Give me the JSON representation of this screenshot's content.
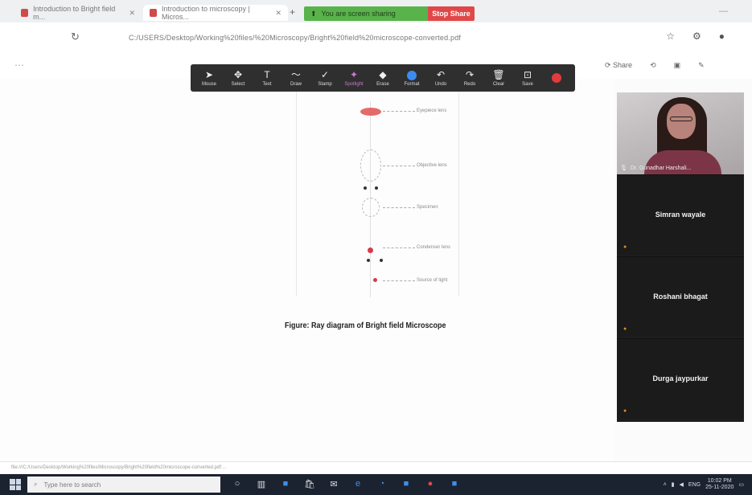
{
  "browser": {
    "tabs": [
      {
        "label": "Introduction to Bright field m..."
      },
      {
        "label": "Introduction to microscopy | Micros..."
      }
    ],
    "new_tab": "+",
    "share": {
      "status": "You are screen sharing",
      "stop_label": "Stop Share"
    },
    "minimize": "—",
    "url": "C:/USERS/Desktop/Working%20files/%20Microscopy/Bright%20field%20microscope-converted.pdf",
    "nav": {
      "back": "←",
      "reload": "↻"
    }
  },
  "pdf_toolbar": {
    "share_label": "Share",
    "icons": [
      "share-icon",
      "rotate-icon",
      "save-icon",
      "pen-icon"
    ]
  },
  "annotate_toolbar": {
    "tools": [
      {
        "label": "Mouse",
        "glyph": "➤"
      },
      {
        "label": "Select",
        "glyph": "✥"
      },
      {
        "label": "Text",
        "glyph": "T"
      },
      {
        "label": "Draw",
        "glyph": "〜"
      },
      {
        "label": "Stamp",
        "glyph": "✓"
      },
      {
        "label": "Spotlight",
        "glyph": "✦"
      },
      {
        "label": "Erase",
        "glyph": "◆"
      },
      {
        "label": "Format",
        "glyph": ""
      },
      {
        "label": "Undo",
        "glyph": "↶"
      },
      {
        "label": "Redo",
        "glyph": "↷"
      },
      {
        "label": "Clear",
        "glyph": "🗑"
      },
      {
        "label": "Save",
        "glyph": "⊡"
      }
    ],
    "accent_spotlight": "#c77ad0"
  },
  "document": {
    "diagram_labels": [
      "Eyepiece lens",
      "Objective lens",
      "Specimen",
      "Condenser lens",
      "Source of light"
    ],
    "caption": "Figure: Ray diagram of Bright field Microscope"
  },
  "video_panel": {
    "self": {
      "name": "Dr. Gunadhar Harshali..."
    },
    "participants": [
      {
        "name": "Simran wayale"
      },
      {
        "name": "Roshani bhagat"
      },
      {
        "name": "Durga jaypurkar"
      }
    ]
  },
  "status_url": "file:///C:/Users/Desktop/Working%20files/Microscopy/Bright%20field%20microscope-converted.pdf ...",
  "taskbar": {
    "search_placeholder": "Type here to search",
    "time": "10:02 PM",
    "date": "25-11-2020"
  }
}
